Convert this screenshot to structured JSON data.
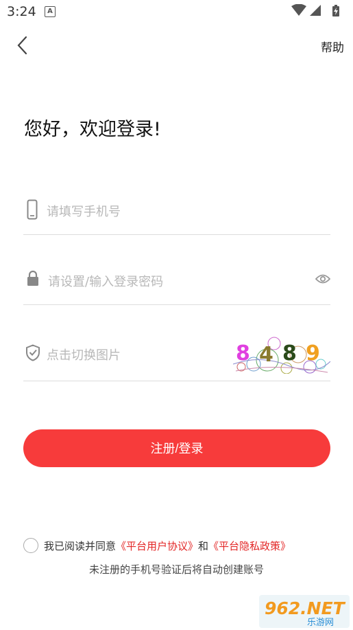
{
  "status_bar": {
    "time": "3:24",
    "notif_glyph": "A"
  },
  "nav": {
    "back_icon": "chevron-left-icon",
    "help_label": "帮助"
  },
  "greeting": "您好，欢迎登录!",
  "phone": {
    "placeholder": "请填写手机号",
    "icon": "mobile-phone-icon"
  },
  "password": {
    "placeholder": "请设置/输入登录密码",
    "icon": "lock-icon",
    "toggle_icon": "eye-icon"
  },
  "captcha": {
    "placeholder": "点击切换图片",
    "icon": "shield-check-icon",
    "code": [
      "8",
      "4",
      "8",
      "9"
    ]
  },
  "submit_label": "注册/登录",
  "agreement": {
    "prefix": "我已阅读并同意",
    "user_agreement": "《平台用户协议》",
    "and": "和",
    "privacy_policy": "《平台隐私政策》",
    "note": "未注册的手机号验证后将自动创建账号"
  },
  "watermark": {
    "main": "962.NET",
    "sub": "乐游网"
  },
  "colors": {
    "accent": "#f73b3b",
    "link": "#e32727",
    "placeholder": "#b8b8b8"
  }
}
